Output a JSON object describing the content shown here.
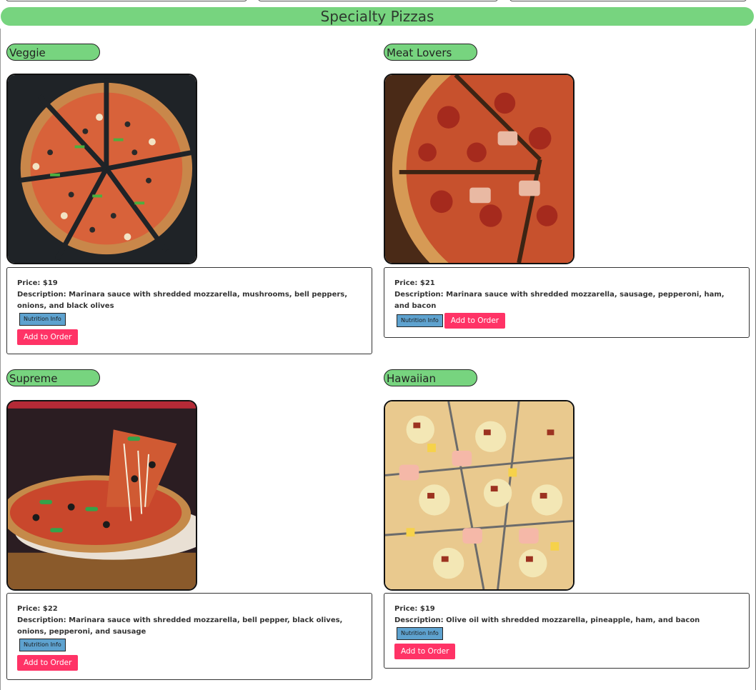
{
  "section_title": "Specialty Pizzas",
  "price_prefix": "Price: ",
  "description_prefix": "Description: ",
  "nutrition_label": "Nutrition Info",
  "order_label": "Add to Order",
  "pizzas": [
    {
      "name": "Veggie",
      "price": "$19",
      "description": "Marinara sauce with shredded mozzarella, mushrooms, bell peppers, onions, and black olives"
    },
    {
      "name": "Meat Lovers",
      "price": "$21",
      "description": "Marinara sauce with shredded mozzarella, sausage, pepperoni, ham, and bacon"
    },
    {
      "name": "Supreme",
      "price": "$22",
      "description": "Marinara sauce with shredded mozzarella, bell pepper, black olives, onions, pepperoni, and sausage"
    },
    {
      "name": "Hawaiian",
      "price": "$19",
      "description": "Olive oil with shredded mozzarella, pineapple, ham, and bacon"
    }
  ]
}
